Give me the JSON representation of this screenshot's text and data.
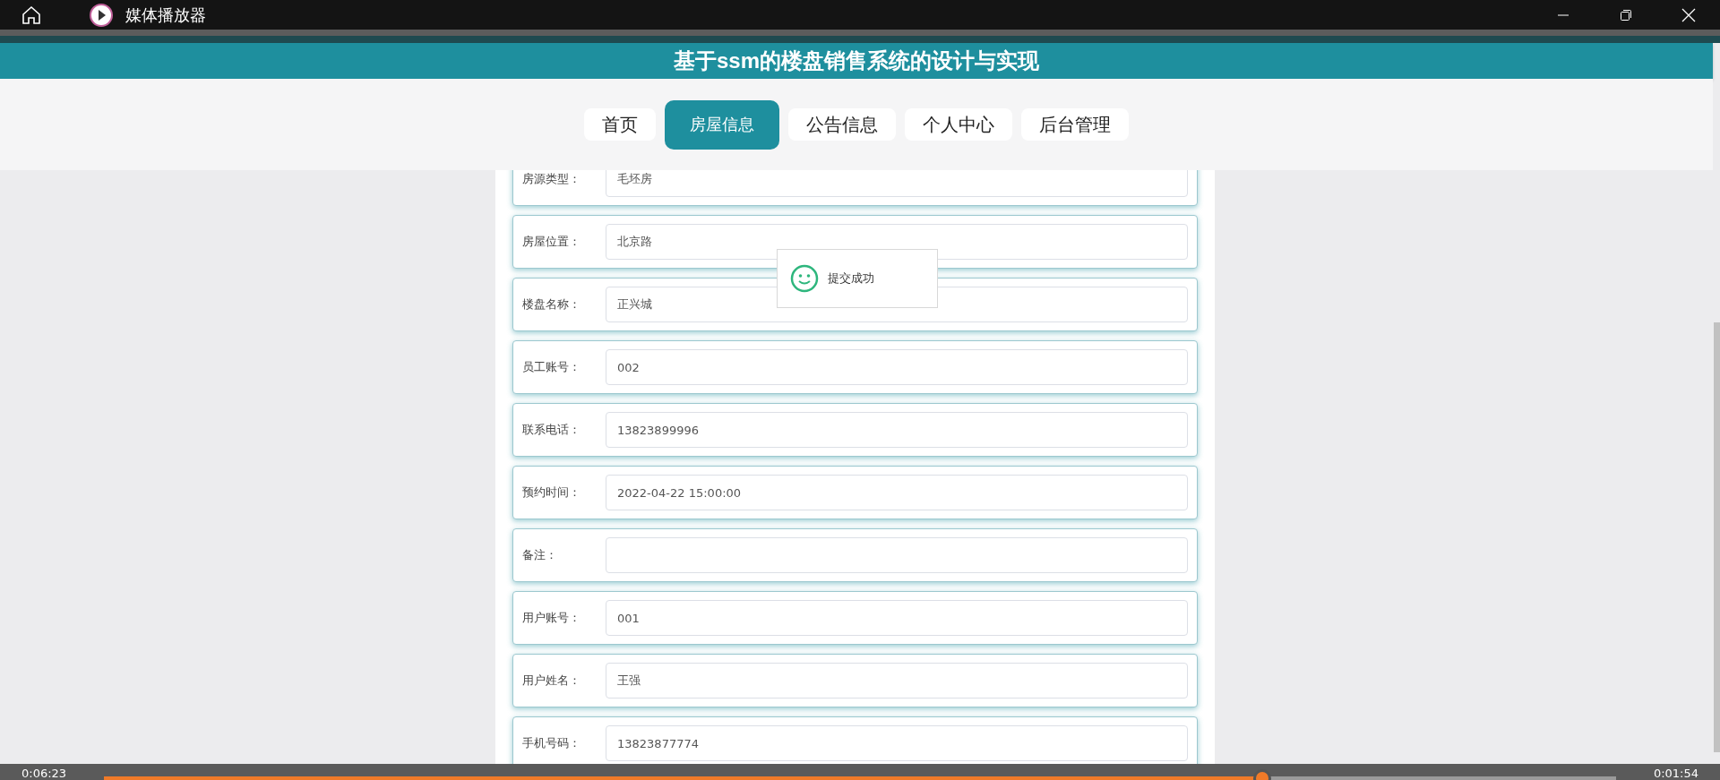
{
  "window": {
    "title": "媒体播放器"
  },
  "site_title": "基于ssm的楼盘销售系统的设计与实现",
  "tabs": [
    {
      "label": "首页",
      "selected": false
    },
    {
      "label": "房屋信息",
      "selected": true
    },
    {
      "label": "公告信息",
      "selected": false
    },
    {
      "label": "个人中心",
      "selected": false
    },
    {
      "label": "后台管理",
      "selected": false
    }
  ],
  "form": [
    {
      "label": "房源类型：",
      "value": "毛坯房"
    },
    {
      "label": "房屋位置：",
      "value": "北京路"
    },
    {
      "label": "楼盘名称：",
      "value": "正兴城"
    },
    {
      "label": "员工账号：",
      "value": "002"
    },
    {
      "label": "联系电话：",
      "value": "13823899996"
    },
    {
      "label": "预约时间：",
      "value": "2022-04-22 15:00:00"
    },
    {
      "label": "备注："
    },
    {
      "label": "用户账号：",
      "value": "001"
    },
    {
      "label": "用户姓名：",
      "value": "王强"
    },
    {
      "label": "手机号码：",
      "value": "13823877774"
    }
  ],
  "toast": {
    "message": "提交成功"
  },
  "player": {
    "elapsed": "0:06:23",
    "remaining": "0:01:54",
    "progress": {
      "level": 0.766
    }
  }
}
